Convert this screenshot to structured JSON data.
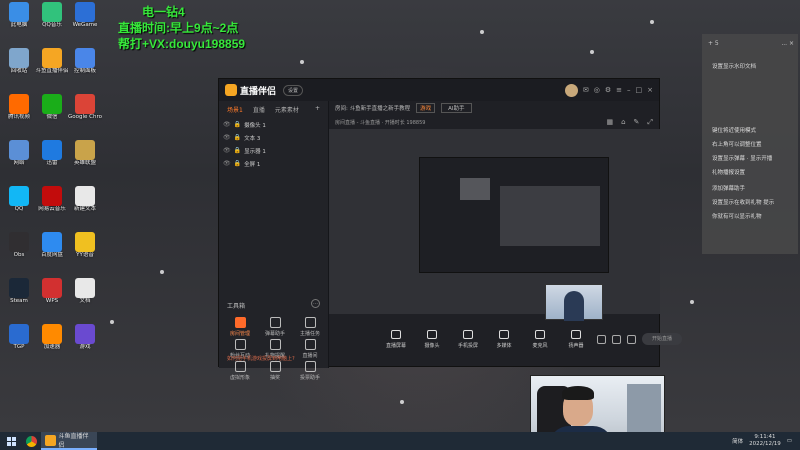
{
  "overlay": {
    "line1": "电一钻4",
    "line2": "直播时间:早上9点~2点",
    "line3": "帮打+VX:douyu198859"
  },
  "desktop_icons": [
    {
      "label": "此电脑",
      "color": "#3a8ee6"
    },
    {
      "label": "QQ音乐",
      "color": "#31c27c"
    },
    {
      "label": "WeGame",
      "color": "#2c6fd6"
    },
    {
      "label": "回收站",
      "color": "#7fa6cc"
    },
    {
      "label": "斗鱼直播伴侣",
      "color": "#f5a623"
    },
    {
      "label": "控制面板",
      "color": "#4a86e8"
    },
    {
      "label": "腾讯视频",
      "color": "#ff6a00"
    },
    {
      "label": "微信",
      "color": "#1aad19"
    },
    {
      "label": "Google Chrome",
      "color": "#db4437"
    },
    {
      "label": "网络",
      "color": "#5b8fd6"
    },
    {
      "label": "迅雷",
      "color": "#1f7ae0"
    },
    {
      "label": "英雄联盟",
      "color": "#c9a34a"
    },
    {
      "label": "QQ",
      "color": "#12b7f5"
    },
    {
      "label": "网易云音乐",
      "color": "#c20c0c"
    },
    {
      "label": "新建文本",
      "color": "#e8e8e8"
    },
    {
      "label": "Obs",
      "color": "#302e31"
    },
    {
      "label": "百度网盘",
      "color": "#2e8bf0"
    },
    {
      "label": "YY语音",
      "color": "#f0c020"
    },
    {
      "label": "Steam",
      "color": "#1b2838"
    },
    {
      "label": "WPS",
      "color": "#d23030"
    },
    {
      "label": "文档",
      "color": "#e8e8e8"
    },
    {
      "label": "TGP",
      "color": "#2a6bd0"
    },
    {
      "label": "加速器",
      "color": "#ff8a00"
    },
    {
      "label": "游戏",
      "color": "#6a4ad0"
    }
  ],
  "notes": {
    "header_left": "+ 5",
    "header_right": "...  ×",
    "lines": [
      "设置显示水印文档",
      "键位将近使用模式",
      "右上角可以调整位置",
      "设置显示弹幕 · 显示开播",
      "礼物播报设置",
      "添加弹幕助手",
      "设置显示在收到礼物 提示",
      "你就有可以显示礼物"
    ]
  },
  "app": {
    "name": "直播伴侣",
    "version_pill": "设置",
    "tabs": [
      "场景1",
      "直播",
      "元素素材"
    ],
    "sources": [
      {
        "name": "摄像头 1"
      },
      {
        "name": "文本 3"
      },
      {
        "name": "显示器 1"
      },
      {
        "name": "全屏 1"
      }
    ],
    "tools_title": "工具箱",
    "tools": [
      {
        "label": "房间管理",
        "hot": true
      },
      {
        "label": "弹幕助手",
        "hot": false
      },
      {
        "label": "主播任务",
        "hot": false
      },
      {
        "label": "粉丝互动",
        "hot": false
      },
      {
        "label": "礼物提醒",
        "hot": false
      },
      {
        "label": "直播间",
        "hot": false
      },
      {
        "label": "虚拟形象",
        "hot": false
      },
      {
        "label": "抽奖",
        "hot": false
      },
      {
        "label": "投票助手",
        "hot": false
      }
    ],
    "warning": "如何把手机游戏投屏到电脑上?",
    "topbar": {
      "title": "房间: 斗鱼新手直播之新手教程",
      "tag": "游戏",
      "box": "AI助手"
    },
    "subbar": "房间直播 - 斗鱼直播  ·  开播时长  198859",
    "controls": [
      {
        "label": "直播屏幕"
      },
      {
        "label": "摄像头"
      },
      {
        "label": "手机投屏"
      },
      {
        "label": "多媒体"
      },
      {
        "label": "麦克风"
      },
      {
        "label": "扬声器"
      }
    ],
    "start_label": "开始直播"
  },
  "taskbar": {
    "app_label": "斗鱼直播伴侣",
    "tray_label": "简体",
    "time": "9:11:41",
    "date": "2022/12/19"
  }
}
